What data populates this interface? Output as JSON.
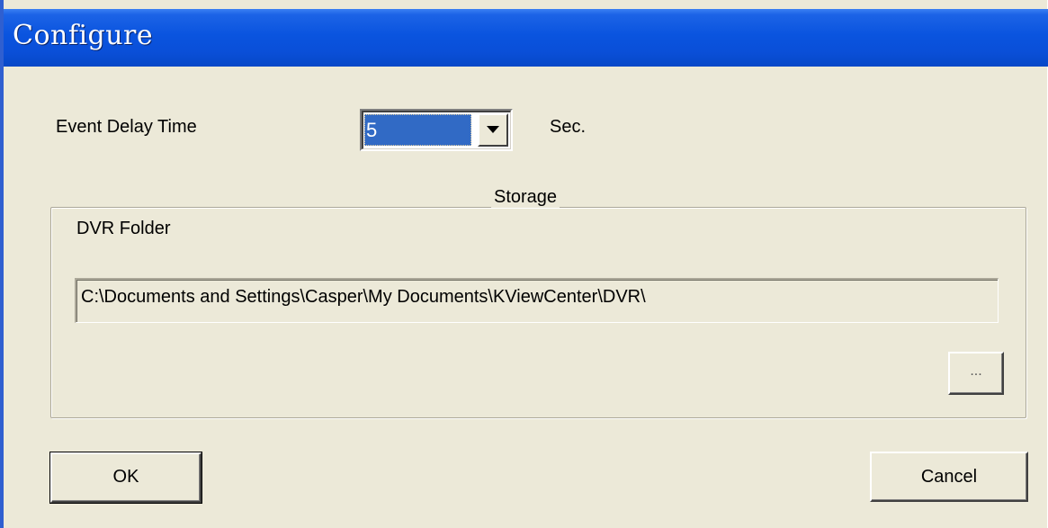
{
  "window": {
    "title": "Configure"
  },
  "event_delay": {
    "label": "Event Delay Time",
    "selected_value": "5",
    "unit": "Sec."
  },
  "storage": {
    "group_title": "Storage",
    "folder_label": "DVR Folder",
    "folder_path": "C:\\Documents and Settings\\Casper\\My Documents\\KViewCenter\\DVR\\",
    "browse_label": "..."
  },
  "buttons": {
    "ok_label": "OK",
    "cancel_label": "Cancel"
  },
  "colors": {
    "titlebar": "#0a54df",
    "dialog_bg": "#ece9d8",
    "selection": "#316ac5"
  }
}
